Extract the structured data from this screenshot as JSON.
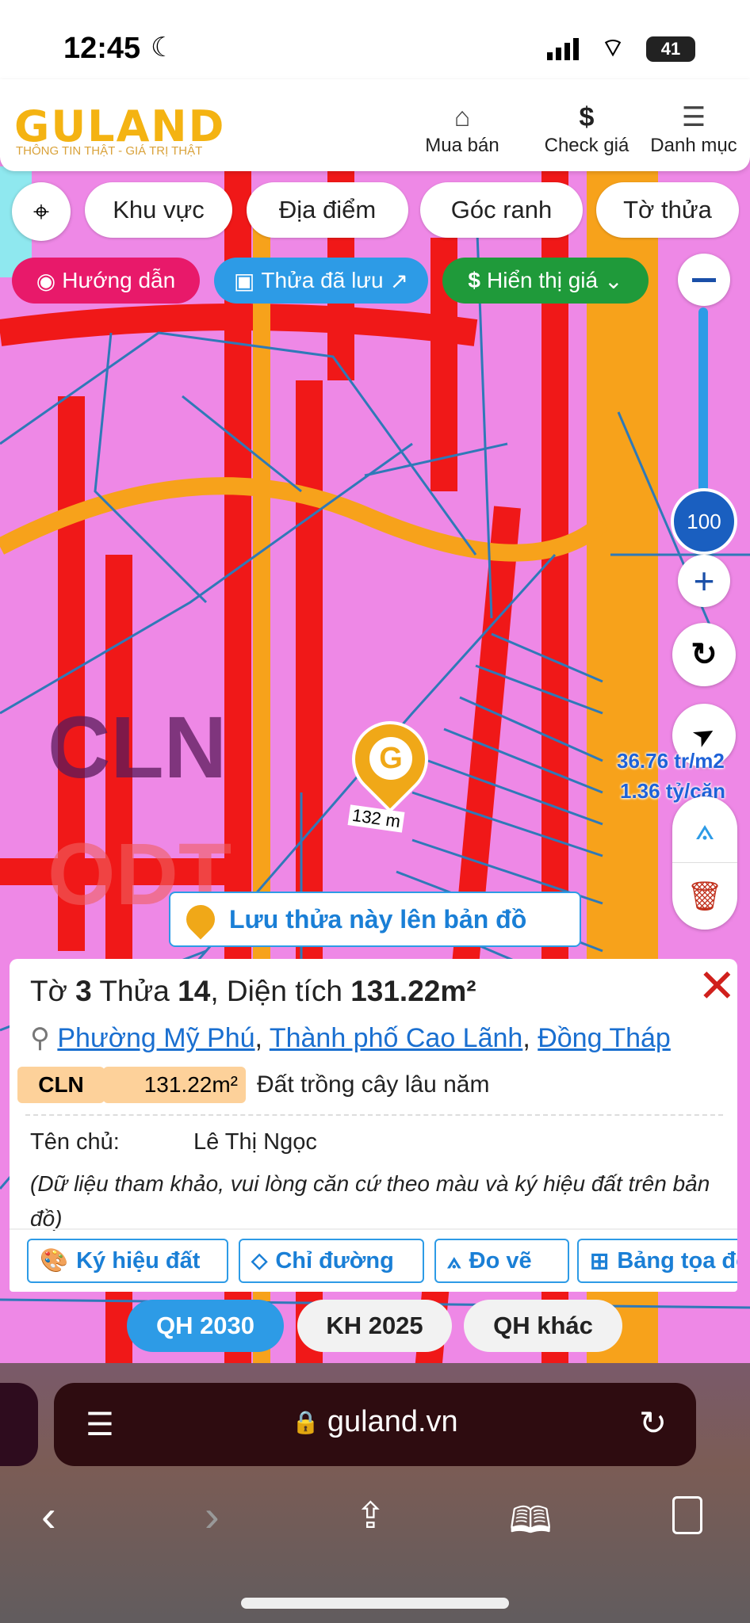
{
  "status_bar": {
    "time": "12:45",
    "battery": "41"
  },
  "header": {
    "logo": "GULAND",
    "tagline": "THÔNG TIN THẬT - GIÁ TRỊ THẬT",
    "nav": [
      {
        "label": "Mua bán",
        "icon": "building-icon"
      },
      {
        "label": "Check giá",
        "icon": "dollar-icon"
      },
      {
        "label": "Danh mục",
        "icon": "menu-icon"
      }
    ]
  },
  "filters": [
    "Khu vực",
    "Địa điểm",
    "Góc ranh",
    "Tờ thửa"
  ],
  "pills": {
    "guide": "Hướng dẫn",
    "saved": "Thửa đã lưu",
    "price": "Hiển thị giá"
  },
  "zoom": {
    "level": "100"
  },
  "map": {
    "zone_label": "CLN",
    "zone_label2": "ODT",
    "edge_length": "132 m",
    "price_per_m2": "36.76 tr/m2",
    "price_unit": "1.36 tỷ/căn"
  },
  "save_button": "Lưu thửa này lên bản đồ",
  "parcel": {
    "sheet_label": "Tờ",
    "sheet": "3",
    "lot_label": "Thửa",
    "lot": "14",
    "area_label": ", Diện tích",
    "area": "131.22m²",
    "ward": "Phường Mỹ Phú",
    "city": "Thành phố Cao Lãnh",
    "province": "Đồng Tháp",
    "land_code": "CLN",
    "land_area": "131.22m²",
    "land_type": "Đất trồng cây lâu năm",
    "owner_label": "Tên chủ:",
    "owner": "Lê Thị Ngọc",
    "note": "(Dữ liệu tham khảo, vui lòng căn cứ theo màu và ký hiệu đất trên bản đồ)",
    "actions": [
      "Ký hiệu đất",
      "Chỉ đường",
      "Đo vẽ",
      "Bảng tọa độ"
    ]
  },
  "layers": [
    {
      "label": "QH 2030",
      "active": true
    },
    {
      "label": "KH 2025",
      "active": false
    },
    {
      "label": "QH khác",
      "active": false
    }
  ],
  "browser": {
    "url": "guland.vn"
  },
  "colors": {
    "brand": "#f4b312",
    "blue": "#2d9be6",
    "red": "#e02020",
    "pink": "#ee88e6",
    "green": "#1f9a3a",
    "guide": "#e8196a"
  }
}
